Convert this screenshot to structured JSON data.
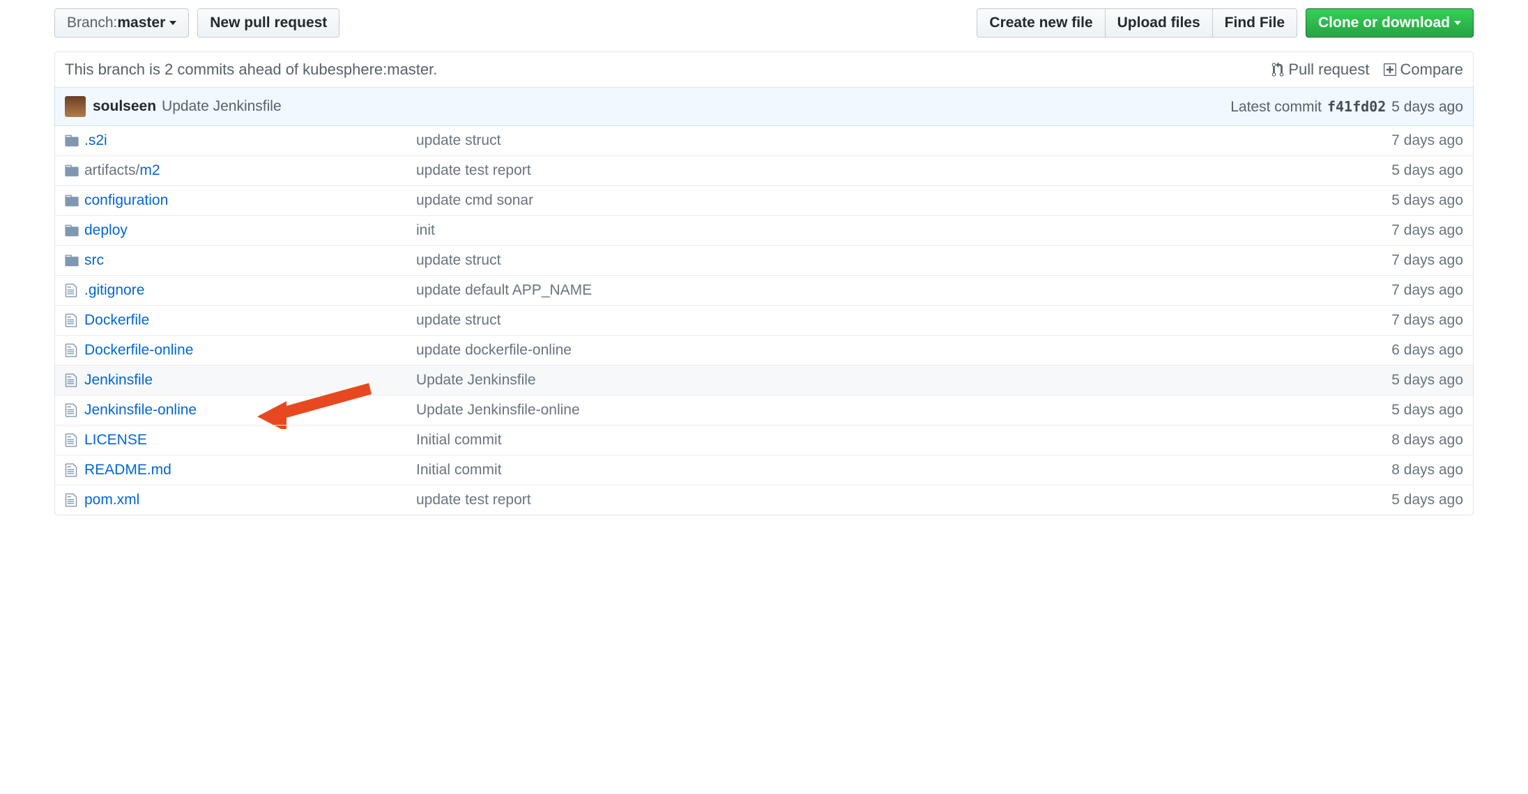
{
  "toolbar": {
    "branch_label": "Branch: ",
    "branch_value": "master",
    "new_pr": "New pull request",
    "create_file": "Create new file",
    "upload_files": "Upload files",
    "find_file": "Find File",
    "clone": "Clone or download"
  },
  "tease": {
    "text": "This branch is 2 commits ahead of kubesphere:master.",
    "pull_request": "Pull request",
    "compare": "Compare"
  },
  "commit": {
    "author": "soulseen",
    "message": "Update Jenkinsfile",
    "latest_label": "Latest commit",
    "sha": "f41fd02",
    "age": "5 days ago"
  },
  "files": [
    {
      "type": "dir",
      "name": ".s2i",
      "msg": "update struct",
      "age": "7 days ago"
    },
    {
      "type": "dir",
      "name_prefix": "artifacts/",
      "name": "m2",
      "msg": "update test report",
      "age": "5 days ago"
    },
    {
      "type": "dir",
      "name": "configuration",
      "msg": "update cmd sonar",
      "age": "5 days ago"
    },
    {
      "type": "dir",
      "name": "deploy",
      "msg": "init",
      "age": "7 days ago"
    },
    {
      "type": "dir",
      "name": "src",
      "msg": "update struct",
      "age": "7 days ago"
    },
    {
      "type": "file",
      "name": ".gitignore",
      "msg": "update default APP_NAME",
      "age": "7 days ago"
    },
    {
      "type": "file",
      "name": "Dockerfile",
      "msg": "update struct",
      "age": "7 days ago"
    },
    {
      "type": "file",
      "name": "Dockerfile-online",
      "msg": "update dockerfile-online",
      "age": "6 days ago"
    },
    {
      "type": "file",
      "name": "Jenkinsfile",
      "msg": "Update Jenkinsfile",
      "age": "5 days ago",
      "highlight": true
    },
    {
      "type": "file",
      "name": "Jenkinsfile-online",
      "msg": "Update Jenkinsfile-online",
      "age": "5 days ago",
      "arrow": true
    },
    {
      "type": "file",
      "name": "LICENSE",
      "msg": "Initial commit",
      "age": "8 days ago"
    },
    {
      "type": "file",
      "name": "README.md",
      "msg": "Initial commit",
      "age": "8 days ago"
    },
    {
      "type": "file",
      "name": "pom.xml",
      "msg": "update test report",
      "age": "5 days ago"
    }
  ]
}
